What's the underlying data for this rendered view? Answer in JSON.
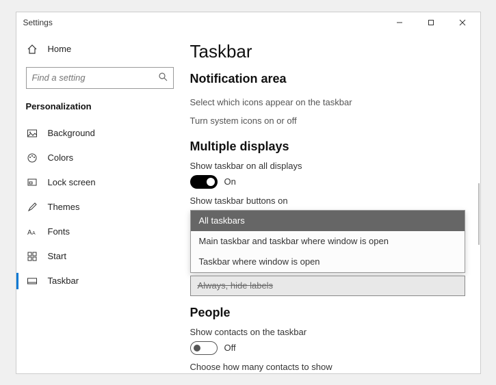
{
  "titlebar": {
    "title": "Settings"
  },
  "sidebar": {
    "home_label": "Home",
    "search_placeholder": "Find a setting",
    "section_label": "Personalization",
    "items": [
      {
        "label": "Background"
      },
      {
        "label": "Colors"
      },
      {
        "label": "Lock screen"
      },
      {
        "label": "Themes"
      },
      {
        "label": "Fonts"
      },
      {
        "label": "Start"
      },
      {
        "label": "Taskbar"
      }
    ]
  },
  "content": {
    "page_title": "Taskbar",
    "notif_heading": "Notification area",
    "notif_link1": "Select which icons appear on the taskbar",
    "notif_link2": "Turn system icons on or off",
    "multi_heading": "Multiple displays",
    "show_all_label": "Show taskbar on all displays",
    "toggle_on_state": "On",
    "show_buttons_label": "Show taskbar buttons on",
    "dropdown_options": [
      "All taskbars",
      "Main taskbar and taskbar where window is open",
      "Taskbar where window is open"
    ],
    "underlying_dropdown_value": "Always, hide labels",
    "people_heading": "People",
    "show_contacts_label": "Show contacts on the taskbar",
    "toggle_off_state": "Off",
    "choose_contacts_label": "Choose how many contacts to show"
  }
}
